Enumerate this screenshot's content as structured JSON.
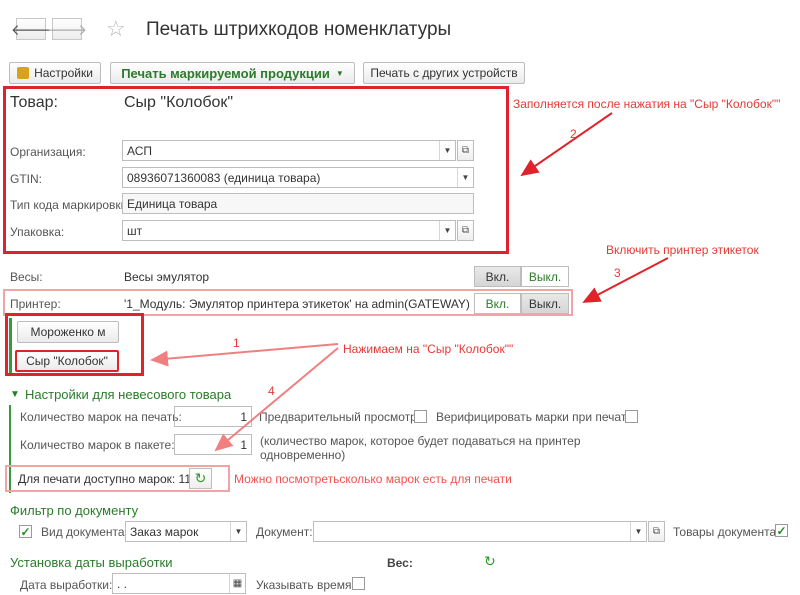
{
  "header": {
    "back_icon": "arrow-left-icon",
    "forward_icon": "arrow-right-icon",
    "favorite_icon": "star-icon",
    "title": "Печать штрихкодов номенклатуры"
  },
  "toolbar": {
    "settings_label": "Настройки",
    "print_marked_label": "Печать маркируемой продукции",
    "print_other_label": "Печать с других устройств"
  },
  "product": {
    "caption": "Товар:",
    "name": "Сыр \"Колобок\"",
    "org_label": "Организация:",
    "org_value": "АСП",
    "gtin_label": "GTIN:",
    "gtin_value": "08936071360083 (единица товара)",
    "code_type_label": "Тип кода маркировки:",
    "code_type_value": "Единица товара",
    "pack_label": "Упаковка:",
    "pack_value": "шт"
  },
  "devices": {
    "scales_label": "Весы:",
    "scales_value": "Весы эмулятор",
    "on_label": "Вкл.",
    "off_label": "Выкл.",
    "printer_label": "Принтер:",
    "printer_value": "'1_Модуль: Эмулятор принтера этикеток' на admin(GATEWAY)"
  },
  "product_buttons": {
    "ice_cream": "Мороженко м",
    "cheese": "Сыр \"Колобок\""
  },
  "nonweight": {
    "header": "Настройки для невесового товара",
    "marks_to_print_label": "Количество марок на печать:",
    "marks_to_print_value": "1",
    "preview_label": "Предварительный просмотр:",
    "verify_label": "Верифицировать марки при печати:",
    "marks_in_pack_label": "Количество марок в пакете:",
    "marks_in_pack_value": "1",
    "marks_in_pack_hint": "(количество марок, которое будет подаваться на принтер одновременно)",
    "available_label": "Для печати доступно марок: 11"
  },
  "filter": {
    "header": "Фильтр по документу",
    "doc_type_label": "Вид документа:",
    "doc_type_value": "Заказ марок",
    "doc_label": "Документ:",
    "doc_value": "",
    "goods_label": "Товары документа:"
  },
  "production_date": {
    "header": "Установка даты выработки",
    "weight_label": "Вес:",
    "date_label": "Дата выработки:",
    "date_value": " .  .",
    "show_time_label": "Указывать время:"
  },
  "annotations": {
    "n1": "1",
    "n2": "2",
    "n3": "3",
    "n4": "4",
    "fill_after_click": "Заполняется после нажатия на \"Сыр \"Колобок\"\"",
    "enable_printer": "Включить принтер этикеток",
    "click_cheese": "Нажимаем на \"Сыр \"Колобок\"\"",
    "see_marks": "Можно посмотретьсколько марок есть для печати"
  },
  "colors": {
    "accent_green": "#2c7a2c",
    "annotation_red": "#e0232a",
    "annotation_pink": "#f2a3a3"
  }
}
